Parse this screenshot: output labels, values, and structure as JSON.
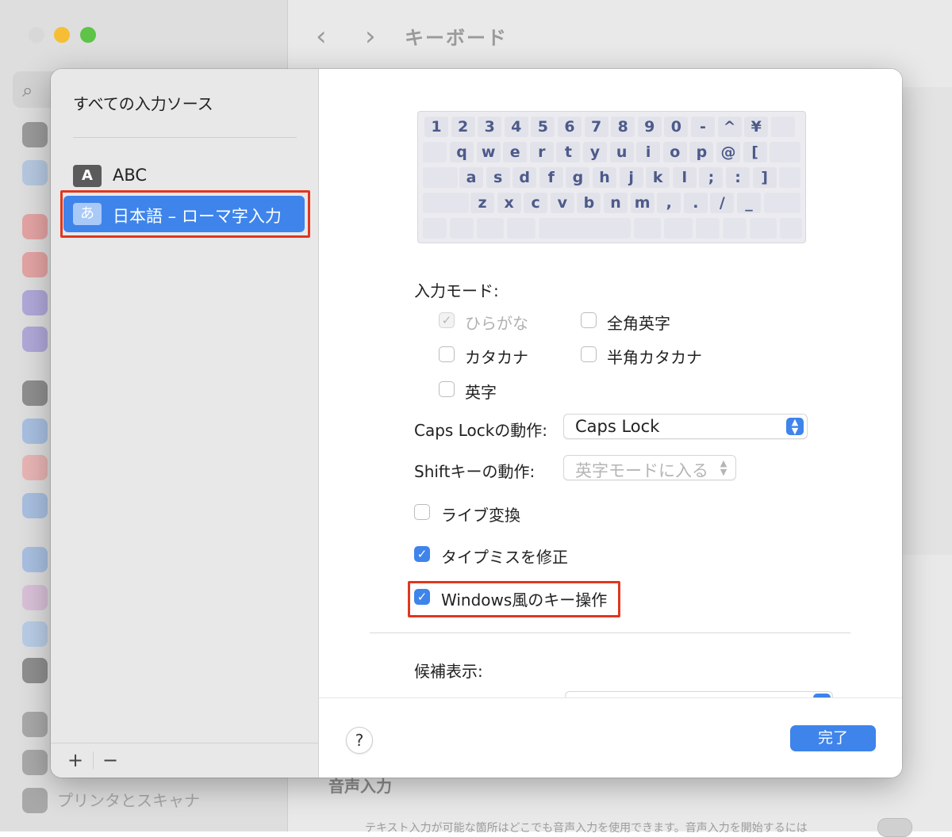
{
  "background": {
    "title": "キーボード",
    "sidebar_bottom_label": "プリンタとスキャナ",
    "section_label": "音声入力",
    "section_desc": "テキスト入力が可能な箇所はどこでも音声入力を使用できます。音声入力を開始するには"
  },
  "sources": {
    "title": "すべての入力ソース",
    "items": [
      {
        "badge": "A",
        "label": "ABC"
      },
      {
        "badge": "あ",
        "label": "日本語 – ローマ字入力"
      }
    ],
    "add_label": "+",
    "remove_label": "−"
  },
  "keyboard": {
    "rows": [
      [
        "1",
        "2",
        "3",
        "4",
        "5",
        "6",
        "7",
        "8",
        "9",
        "0",
        "-",
        "^",
        "¥"
      ],
      [
        "q",
        "w",
        "e",
        "r",
        "t",
        "y",
        "u",
        "i",
        "o",
        "p",
        "@",
        "["
      ],
      [
        "a",
        "s",
        "d",
        "f",
        "g",
        "h",
        "j",
        "k",
        "l",
        ";",
        ":",
        "]"
      ],
      [
        "z",
        "x",
        "c",
        "v",
        "b",
        "n",
        "m",
        ",",
        ".",
        "/",
        "_"
      ]
    ]
  },
  "settings": {
    "input_mode_label": "入力モード:",
    "modes": [
      {
        "label": "ひらがな",
        "checked": true,
        "disabled": true
      },
      {
        "label": "全角英字",
        "checked": false
      },
      {
        "label": "カタカナ",
        "checked": false
      },
      {
        "label": "半角カタカナ",
        "checked": false
      },
      {
        "label": "英字",
        "checked": false
      }
    ],
    "caps_lock_label": "Caps Lockの動作:",
    "caps_lock_value": "Caps Lock",
    "shift_label": "Shiftキーの動作:",
    "shift_value": "英字モードに入る",
    "live_conversion": "ライブ変換",
    "typo_fix": "タイプミスを修正",
    "windows_keys": "Windows風のキー操作",
    "candidate_label": "候補表示:"
  },
  "footer": {
    "help_label": "?",
    "done_label": "完了"
  },
  "colors": {
    "accent": "#3e84eb",
    "highlight": "#e0371f"
  }
}
